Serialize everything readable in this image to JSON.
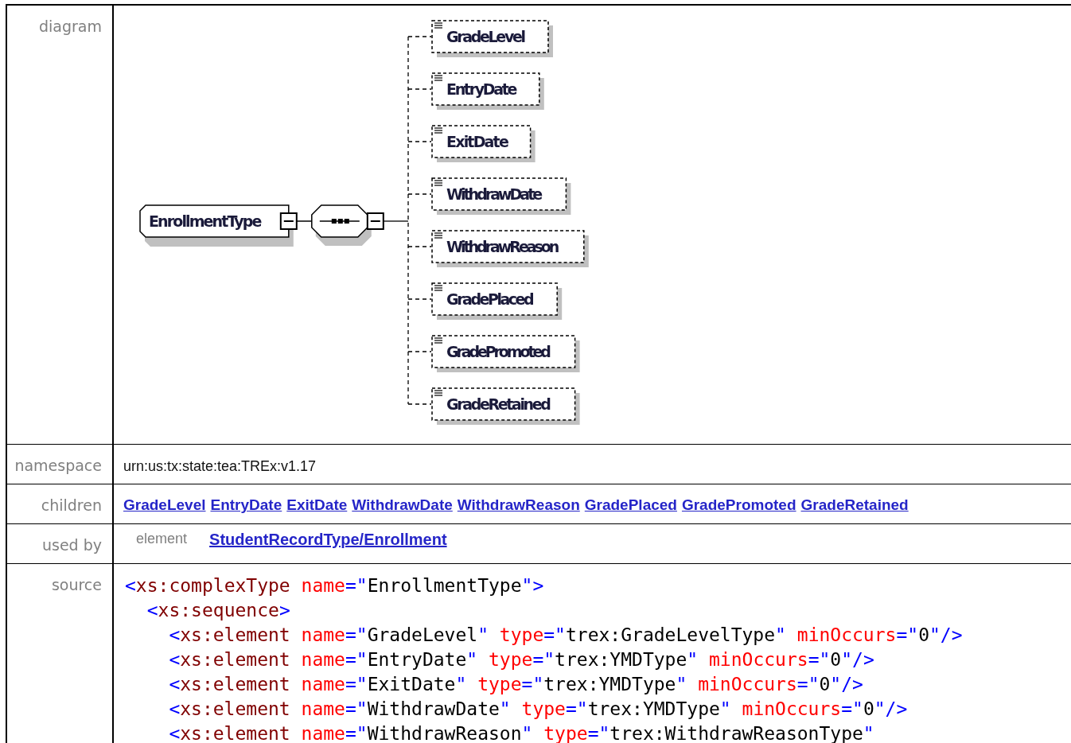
{
  "rows": [
    {
      "kind": "diagram",
      "label": "diagram",
      "root": "EnrollmentType",
      "children": [
        "GradeLevel",
        "EntryDate",
        "ExitDate",
        "WithdrawDate",
        "WithdrawReason",
        "GradePlaced",
        "GradePromoted",
        "GradeRetained"
      ]
    },
    {
      "kind": "text",
      "label": "namespace",
      "value": "urn:us:tx:state:tea:TREx:v1.17"
    },
    {
      "kind": "links",
      "label": "children",
      "links": [
        "GradeLevel",
        "EntryDate",
        "ExitDate",
        "WithdrawDate",
        "WithdrawReason",
        "GradePlaced",
        "GradePromoted",
        "GradeRetained"
      ]
    },
    {
      "kind": "usedby",
      "label": "used by",
      "entries": [
        {
          "type": "element",
          "link": "StudentRecordType/Enrollment"
        }
      ]
    },
    {
      "kind": "source",
      "label": "source",
      "lines": [
        {
          "tokens": [
            {
              "kind": "punct",
              "text": "<"
            },
            {
              "kind": "tag",
              "text": "xs:complexType"
            },
            {
              "kind": "attr",
              "text": " name"
            },
            {
              "kind": "punct",
              "text": "=\""
            },
            {
              "kind": "value",
              "text": "EnrollmentType"
            },
            {
              "kind": "punct",
              "text": "\">"
            }
          ],
          "children": [
            {
              "tokens": [
                {
                  "kind": "punct",
                  "text": "<"
                },
                {
                  "kind": "tag",
                  "text": "xs:sequence"
                },
                {
                  "kind": "punct",
                  "text": ">"
                }
              ],
              "children": [
                {
                  "tokens": [
                    {
                      "kind": "punct",
                      "text": "<"
                    },
                    {
                      "kind": "tag",
                      "text": "xs:element"
                    },
                    {
                      "kind": "attr",
                      "text": " name"
                    },
                    {
                      "kind": "punct",
                      "text": "=\""
                    },
                    {
                      "kind": "value",
                      "text": "GradeLevel"
                    },
                    {
                      "kind": "punct",
                      "text": "\""
                    },
                    {
                      "kind": "attr",
                      "text": " type"
                    },
                    {
                      "kind": "punct",
                      "text": "=\""
                    },
                    {
                      "kind": "value",
                      "text": "trex:GradeLevelType"
                    },
                    {
                      "kind": "punct",
                      "text": "\""
                    },
                    {
                      "kind": "attr",
                      "text": " minOccurs"
                    },
                    {
                      "kind": "punct",
                      "text": "=\""
                    },
                    {
                      "kind": "value",
                      "text": "0"
                    },
                    {
                      "kind": "punct",
                      "text": "\"/>"
                    }
                  ]
                },
                {
                  "tokens": [
                    {
                      "kind": "punct",
                      "text": "<"
                    },
                    {
                      "kind": "tag",
                      "text": "xs:element"
                    },
                    {
                      "kind": "attr",
                      "text": " name"
                    },
                    {
                      "kind": "punct",
                      "text": "=\""
                    },
                    {
                      "kind": "value",
                      "text": "EntryDate"
                    },
                    {
                      "kind": "punct",
                      "text": "\""
                    },
                    {
                      "kind": "attr",
                      "text": " type"
                    },
                    {
                      "kind": "punct",
                      "text": "=\""
                    },
                    {
                      "kind": "value",
                      "text": "trex:YMDType"
                    },
                    {
                      "kind": "punct",
                      "text": "\""
                    },
                    {
                      "kind": "attr",
                      "text": " minOccurs"
                    },
                    {
                      "kind": "punct",
                      "text": "=\""
                    },
                    {
                      "kind": "value",
                      "text": "0"
                    },
                    {
                      "kind": "punct",
                      "text": "\"/>"
                    }
                  ]
                },
                {
                  "tokens": [
                    {
                      "kind": "punct",
                      "text": "<"
                    },
                    {
                      "kind": "tag",
                      "text": "xs:element"
                    },
                    {
                      "kind": "attr",
                      "text": " name"
                    },
                    {
                      "kind": "punct",
                      "text": "=\""
                    },
                    {
                      "kind": "value",
                      "text": "ExitDate"
                    },
                    {
                      "kind": "punct",
                      "text": "\""
                    },
                    {
                      "kind": "attr",
                      "text": " type"
                    },
                    {
                      "kind": "punct",
                      "text": "=\""
                    },
                    {
                      "kind": "value",
                      "text": "trex:YMDType"
                    },
                    {
                      "kind": "punct",
                      "text": "\""
                    },
                    {
                      "kind": "attr",
                      "text": " minOccurs"
                    },
                    {
                      "kind": "punct",
                      "text": "=\""
                    },
                    {
                      "kind": "value",
                      "text": "0"
                    },
                    {
                      "kind": "punct",
                      "text": "\"/>"
                    }
                  ]
                },
                {
                  "tokens": [
                    {
                      "kind": "punct",
                      "text": "<"
                    },
                    {
                      "kind": "tag",
                      "text": "xs:element"
                    },
                    {
                      "kind": "attr",
                      "text": " name"
                    },
                    {
                      "kind": "punct",
                      "text": "=\""
                    },
                    {
                      "kind": "value",
                      "text": "WithdrawDate"
                    },
                    {
                      "kind": "punct",
                      "text": "\""
                    },
                    {
                      "kind": "attr",
                      "text": " type"
                    },
                    {
                      "kind": "punct",
                      "text": "=\""
                    },
                    {
                      "kind": "value",
                      "text": "trex:YMDType"
                    },
                    {
                      "kind": "punct",
                      "text": "\""
                    },
                    {
                      "kind": "attr",
                      "text": " minOccurs"
                    },
                    {
                      "kind": "punct",
                      "text": "=\""
                    },
                    {
                      "kind": "value",
                      "text": "0"
                    },
                    {
                      "kind": "punct",
                      "text": "\"/>"
                    }
                  ]
                },
                {
                  "tokens": [
                    {
                      "kind": "punct",
                      "text": "<"
                    },
                    {
                      "kind": "tag",
                      "text": "xs:element"
                    },
                    {
                      "kind": "attr",
                      "text": " name"
                    },
                    {
                      "kind": "punct",
                      "text": "=\""
                    },
                    {
                      "kind": "value",
                      "text": "WithdrawReason"
                    },
                    {
                      "kind": "punct",
                      "text": "\""
                    },
                    {
                      "kind": "attr",
                      "text": " type"
                    },
                    {
                      "kind": "punct",
                      "text": "=\""
                    },
                    {
                      "kind": "value",
                      "text": "trex:WithdrawReasonType"
                    },
                    {
                      "kind": "punct",
                      "text": "\""
                    }
                  ]
                }
              ]
            }
          ]
        }
      ]
    }
  ]
}
